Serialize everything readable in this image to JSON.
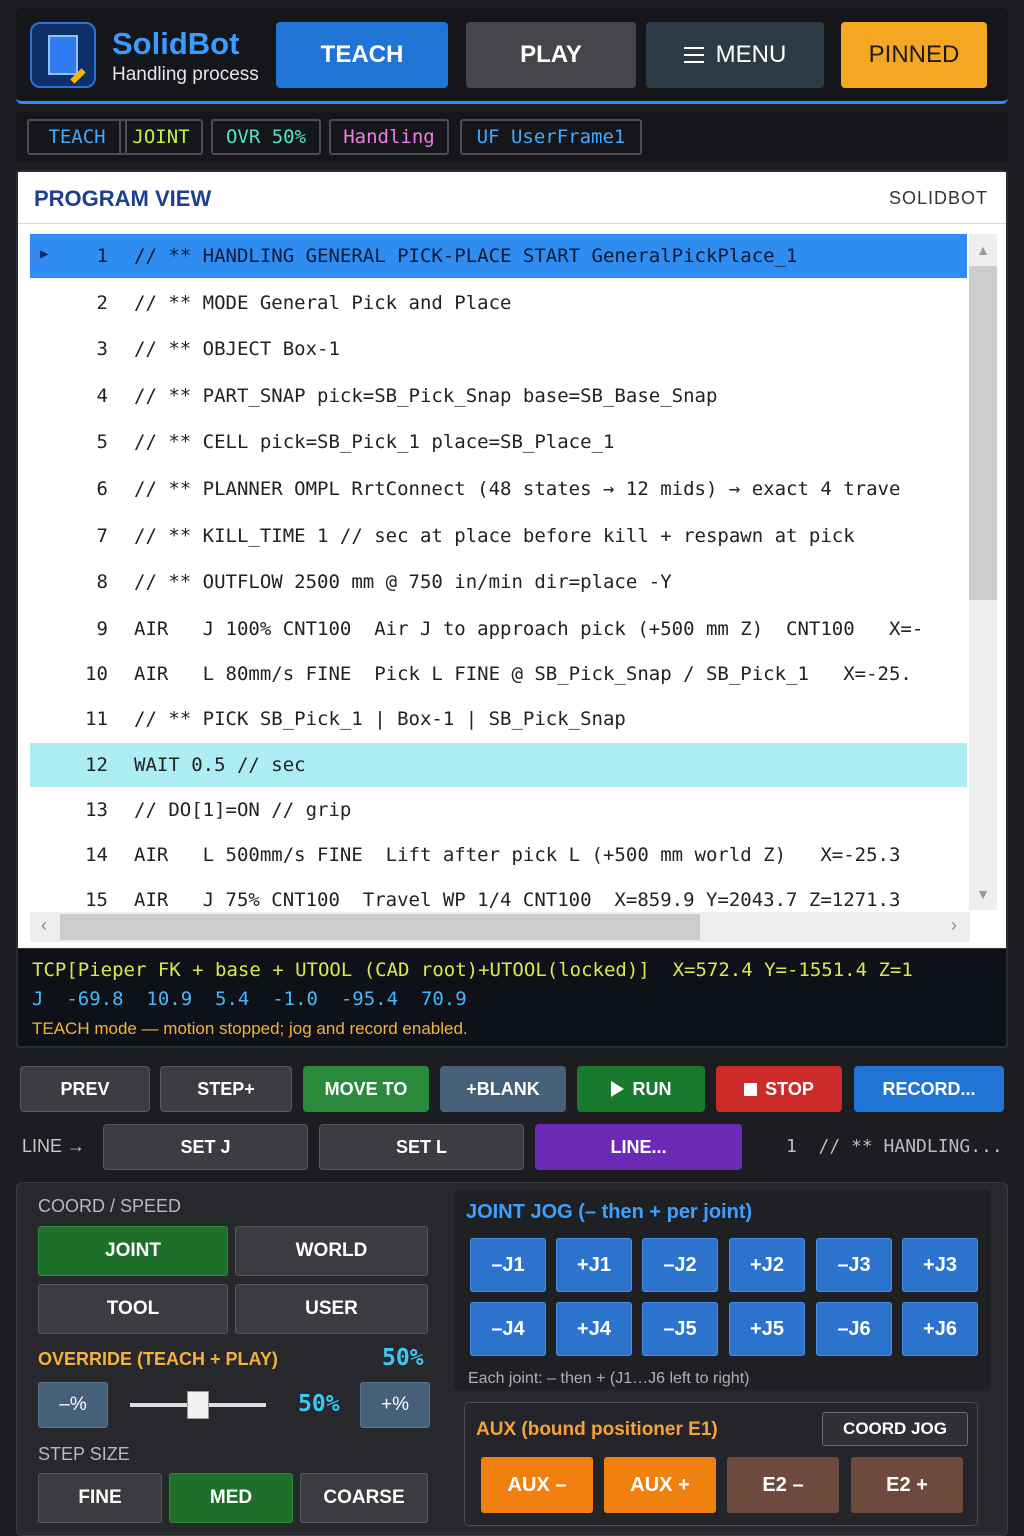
{
  "header": {
    "title": "SolidBot",
    "subtitle": "Handling process",
    "teach_label": "TEACH",
    "play_label": "PLAY",
    "menu_label": "MENU",
    "pinned_label": "PINNED"
  },
  "status_chips": [
    "TEACH",
    "JOINT",
    "OVR 50%",
    "Handling",
    "UF UserFrame1"
  ],
  "program_view": {
    "title": "PROGRAM VIEW",
    "brand": "SOLIDBOT",
    "lines": [
      {
        "num": "1",
        "text": "// ** HANDLING GENERAL PICK-PLACE START GeneralPickPlace_1"
      },
      {
        "num": "2",
        "text": "// ** MODE General Pick and Place"
      },
      {
        "num": "3",
        "text": "// ** OBJECT Box-1"
      },
      {
        "num": "4",
        "text": "// ** PART_SNAP pick=SB_Pick_Snap base=SB_Base_Snap"
      },
      {
        "num": "5",
        "text": "// ** CELL pick=SB_Pick_1 place=SB_Place_1"
      },
      {
        "num": "6",
        "text": "// ** PLANNER OMPL RrtConnect (48 states → 12 mids) → exact 4 trave"
      },
      {
        "num": "7",
        "text": "// ** KILL_TIME 1 // sec at place before kill + respawn at pick"
      },
      {
        "num": "8",
        "text": "// ** OUTFLOW 2500 mm @ 750 in/min dir=place -Y"
      },
      {
        "num": "9",
        "text": "AIR   J 100% CNT100  Air J to approach pick (+500 mm Z)  CNT100   X=-"
      },
      {
        "num": "10",
        "text": "AIR   L 80mm/s FINE  Pick L FINE @ SB_Pick_Snap / SB_Pick_1   X=-25."
      },
      {
        "num": "11",
        "text": "// ** PICK SB_Pick_1 | Box-1 | SB_Pick_Snap"
      },
      {
        "num": "12",
        "text": "WAIT 0.5 // sec"
      },
      {
        "num": "13",
        "text": "// DO[1]=ON // grip"
      },
      {
        "num": "14",
        "text": "AIR   L 500mm/s FINE  Lift after pick L (+500 mm world Z)   X=-25.3"
      },
      {
        "num": "15",
        "text": "AIR   J 75% CNT100  Travel WP 1/4 CNT100  X=859.9 Y=2043.7 Z=1271.3"
      }
    ],
    "tcp_line": "TCP[Pieper FK + base + UTOOL (CAD root)+UTOOL(locked)]  X=572.4 Y=-1551.4 Z=1",
    "joint_line": "J  -69.8  10.9  5.4  -1.0  -95.4  70.9",
    "mode_message": "TEACH mode — motion stopped; jog and record enabled."
  },
  "actions": {
    "prev": "PREV",
    "step": "STEP+",
    "move_to": "MOVE TO",
    "blank": "+BLANK",
    "run": "RUN",
    "stop": "STOP",
    "record": "RECORD..."
  },
  "line_row": {
    "label": "LINE →",
    "set_j": "SET J",
    "set_l": "SET L",
    "line": "LINE...",
    "preview": "1  // ** HANDLING..."
  },
  "coord_speed": {
    "label": "COORD / SPEED",
    "joint": "JOINT",
    "world": "WORLD",
    "tool": "TOOL",
    "user": "USER"
  },
  "override": {
    "label": "OVERRIDE (TEACH + PLAY)",
    "value": "50%",
    "minus": "–%",
    "plus": "+%",
    "slider_value": "50%",
    "slider_fraction": 0.5
  },
  "step_size": {
    "label": "STEP SIZE",
    "fine": "FINE",
    "med": "MED",
    "coarse": "COARSE"
  },
  "joint_jog": {
    "title": "JOINT JOG  (– then + per joint)",
    "buttons": [
      "–J1",
      "+J1",
      "–J2",
      "+J2",
      "–J3",
      "+J3",
      "–J4",
      "+J4",
      "–J5",
      "+J5",
      "–J6",
      "+J6"
    ],
    "note": "Each joint: – then +  (J1…J6 left to right)"
  },
  "aux": {
    "title": "AUX  (bound positioner E1)",
    "coord_jog": "COORD JOG",
    "aux_minus": "AUX –",
    "aux_plus": "AUX +",
    "e2_minus": "E2 –",
    "e2_plus": "E2 +"
  },
  "colors": {
    "accent_blue": "#1f74d6",
    "pinned_orange": "#f5a623",
    "selected_line": "#2f8df2",
    "current_line": "#adeef5",
    "active_green": "#1e6f2a",
    "stop_red": "#cf2a2a",
    "line_purple": "#6b2ab6"
  }
}
